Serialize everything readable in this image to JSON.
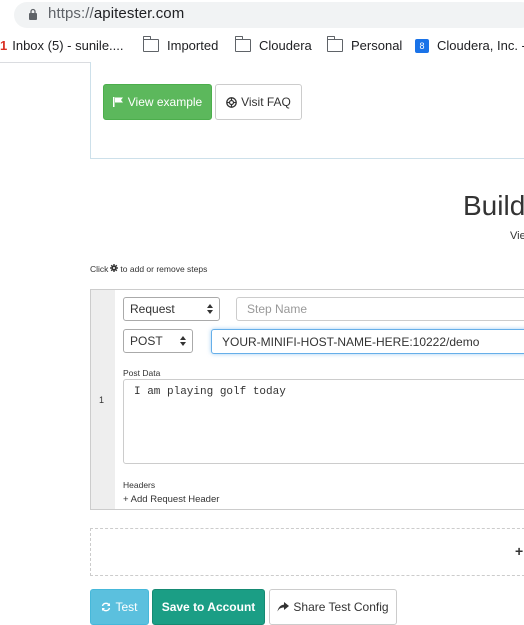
{
  "browser": {
    "url_protocol": "https://",
    "url_host": "apitester.com",
    "bookmarks": {
      "inbox": "Inbox (5) - sunile....",
      "inbox_mark": "1",
      "imported": "Imported",
      "cloudera_folder": "Cloudera",
      "personal": "Personal",
      "cloudera_inc": "Cloudera, Inc. -",
      "calendar_day": "8"
    }
  },
  "top_panel": {
    "view_example": "View example",
    "visit_faq": "Visit FAQ"
  },
  "builder": {
    "title": "Build",
    "subtitle": "Vie"
  },
  "hint": {
    "prefix": "Click",
    "suffix": "to add or remove steps"
  },
  "step": {
    "number": "1",
    "type_select": "Request",
    "name_placeholder": "Step Name",
    "method_select": "POST",
    "url_value": "YOUR-MINIFI-HOST-NAME-HERE:10222/demo",
    "post_data_label": "Post Data",
    "post_data_value": "I am playing golf today",
    "headers_label": "Headers",
    "add_header": "+ Add Request Header"
  },
  "add_step_symbol": "+",
  "actions": {
    "test": "Test",
    "save": "Save to Account",
    "share": "Share Test Config"
  },
  "colors": {
    "green": "#5cb85c",
    "teal": "#1b9e85",
    "info": "#5bc0de"
  }
}
